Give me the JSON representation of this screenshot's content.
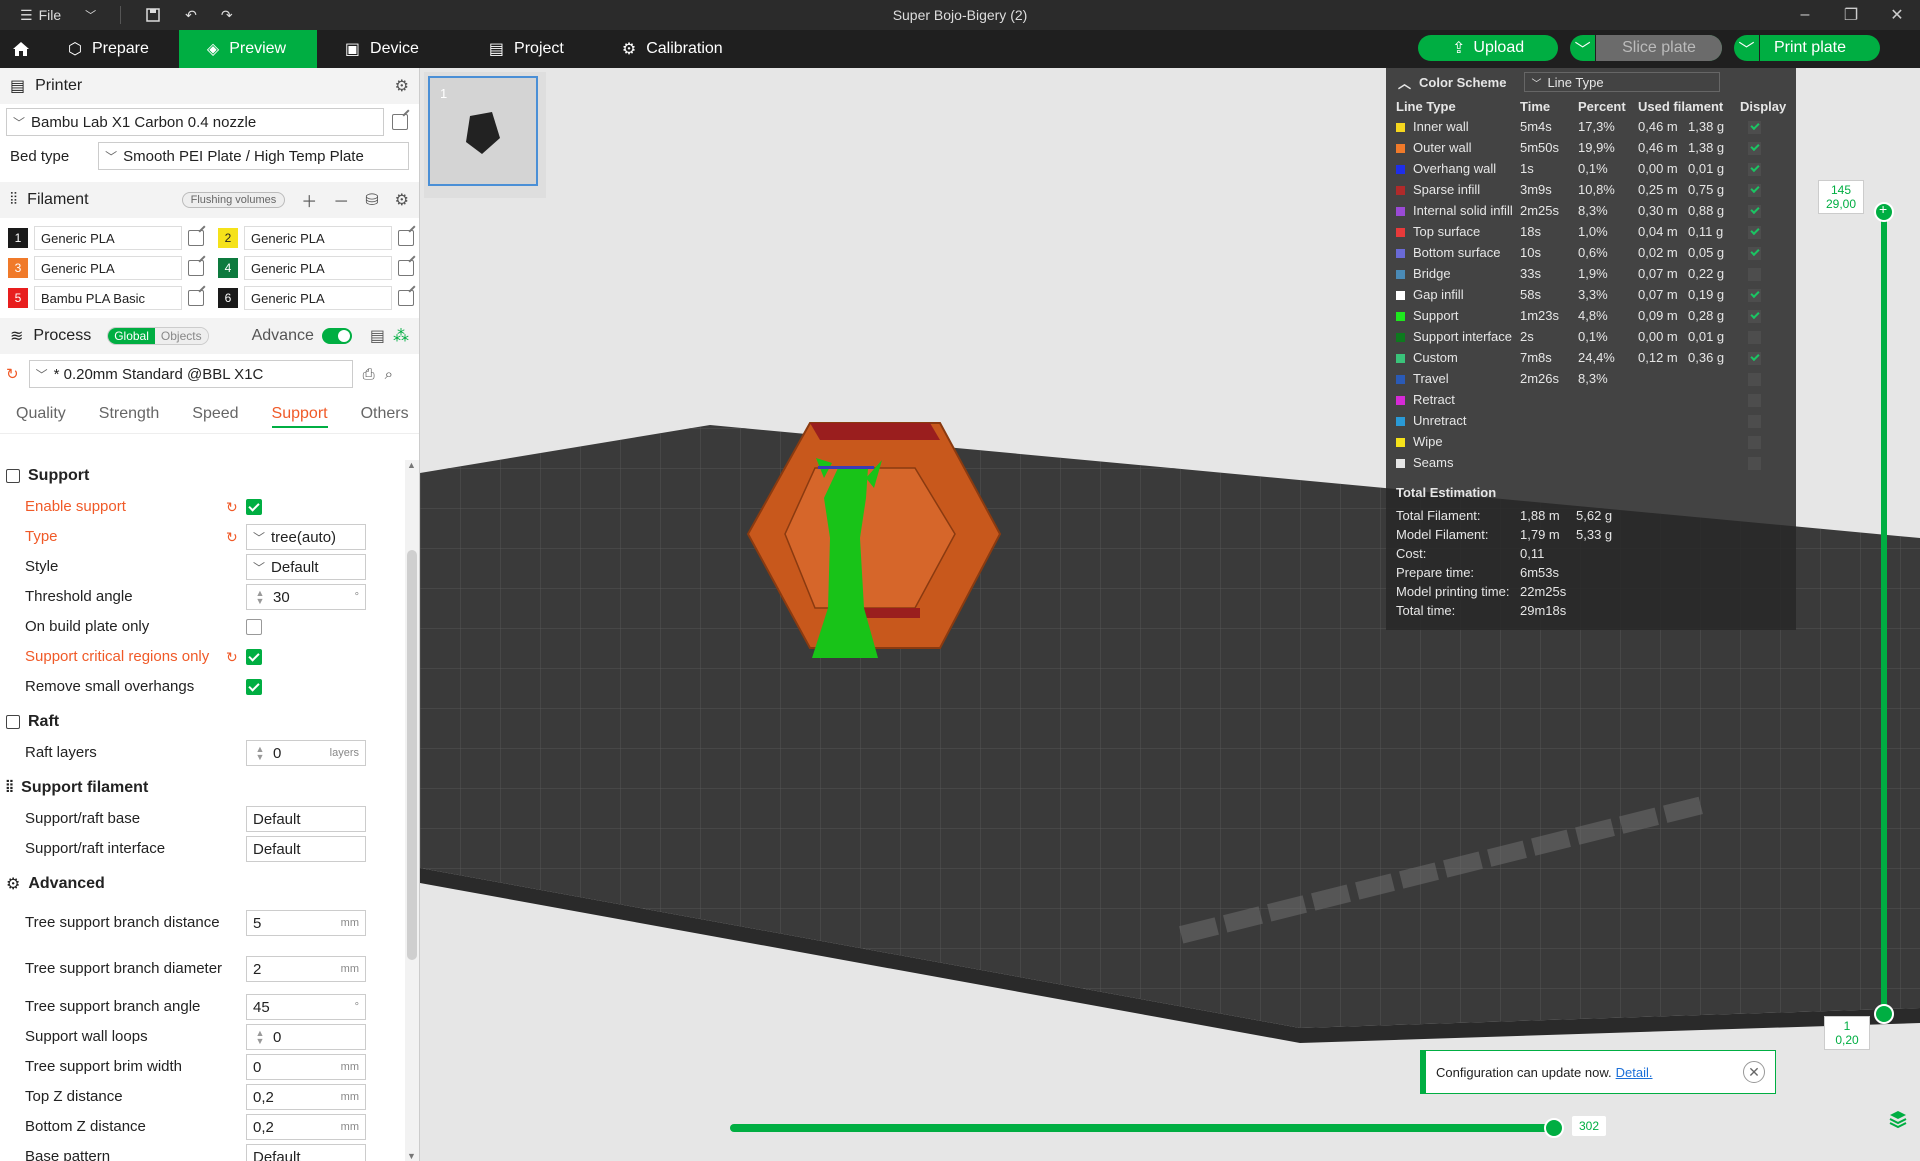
{
  "window": {
    "file_menu": "File",
    "title": "Super Bojo-Bigery (2)"
  },
  "nav": {
    "tabs": [
      {
        "label": "Prepare"
      },
      {
        "label": "Preview"
      },
      {
        "label": "Device"
      },
      {
        "label": "Project"
      },
      {
        "label": "Calibration"
      }
    ],
    "upload": "Upload",
    "slice_plate": "Slice plate",
    "print_plate": "Print plate"
  },
  "printer": {
    "header": "Printer",
    "name": "Bambu Lab X1 Carbon 0.4 nozzle",
    "bed_type_label": "Bed type",
    "bed_type": "Smooth PEI Plate / High Temp Plate"
  },
  "filament": {
    "header": "Filament",
    "flushing": "Flushing volumes",
    "items": [
      {
        "num": "1",
        "color": "#1a1a1a",
        "name": "Generic PLA"
      },
      {
        "num": "2",
        "color": "#f5e21a",
        "name": "Generic PLA"
      },
      {
        "num": "3",
        "color": "#f07a2a",
        "name": "Generic PLA"
      },
      {
        "num": "4",
        "color": "#0d7a3e",
        "name": "Generic PLA"
      },
      {
        "num": "5",
        "color": "#e81e1e",
        "name": "Bambu PLA Basic"
      },
      {
        "num": "6",
        "color": "#1a1a1a",
        "name": "Generic PLA"
      }
    ]
  },
  "process": {
    "header": "Process",
    "global": "Global",
    "objects": "Objects",
    "advance": "Advance",
    "preset": "* 0.20mm Standard @BBL X1C",
    "tabs": [
      "Quality",
      "Strength",
      "Speed",
      "Support",
      "Others"
    ]
  },
  "support": {
    "group": "Support",
    "enable_support": "Enable support",
    "type_label": "Type",
    "type_value": "tree(auto)",
    "style_label": "Style",
    "style_value": "Default",
    "threshold_label": "Threshold angle",
    "threshold_value": "30",
    "threshold_unit": "°",
    "build_plate_only": "On build plate only",
    "critical_regions": "Support critical regions only",
    "remove_small": "Remove small overhangs"
  },
  "raft": {
    "group": "Raft",
    "layers_label": "Raft layers",
    "layers_value": "0",
    "layers_unit": "layers"
  },
  "support_filament": {
    "group": "Support filament",
    "base_label": "Support/raft base",
    "base_value": "Default",
    "interface_label": "Support/raft interface",
    "interface_value": "Default"
  },
  "advanced": {
    "group": "Advanced",
    "branch_distance_label": "Tree support branch distance",
    "branch_distance_value": "5",
    "branch_diameter_label": "Tree support branch diameter",
    "branch_diameter_value": "2",
    "branch_angle_label": "Tree support branch angle",
    "branch_angle_value": "45",
    "wall_loops_label": "Support wall loops",
    "wall_loops_value": "0",
    "brim_width_label": "Tree support brim width",
    "brim_width_value": "0",
    "top_z_label": "Top Z distance",
    "top_z_value": "0,2",
    "bottom_z_label": "Bottom Z distance",
    "bottom_z_value": "0,2",
    "base_pattern_label": "Base pattern",
    "base_pattern_value": "Default",
    "unit_mm": "mm",
    "unit_deg": "°"
  },
  "plate": {
    "number": "1"
  },
  "legend": {
    "color_scheme": "Color Scheme",
    "scheme_value": "Line Type",
    "headers": [
      "Line Type",
      "Time",
      "Percent",
      "Used filament",
      "Display"
    ],
    "rows": [
      {
        "name": "Inner wall",
        "color": "#f5d61e",
        "time": "5m4s",
        "percent": "17,3%",
        "length": "0,46 m",
        "weight": "1,38 g",
        "shown": true
      },
      {
        "name": "Outer wall",
        "color": "#f07a2a",
        "time": "5m50s",
        "percent": "19,9%",
        "length": "0,46 m",
        "weight": "1,38 g",
        "shown": true
      },
      {
        "name": "Overhang wall",
        "color": "#1e2ee8",
        "time": "1s",
        "percent": "0,1%",
        "length": "0,00 m",
        "weight": "0,01 g",
        "shown": true
      },
      {
        "name": "Sparse infill",
        "color": "#b02a2a",
        "time": "3m9s",
        "percent": "10,8%",
        "length": "0,25 m",
        "weight": "0,75 g",
        "shown": true
      },
      {
        "name": "Internal solid infill",
        "color": "#9a4ad6",
        "time": "2m25s",
        "percent": "8,3%",
        "length": "0,30 m",
        "weight": "0,88 g",
        "shown": true
      },
      {
        "name": "Top surface",
        "color": "#e83a3a",
        "time": "18s",
        "percent": "1,0%",
        "length": "0,04 m",
        "weight": "0,11 g",
        "shown": true
      },
      {
        "name": "Bottom surface",
        "color": "#6a6ad6",
        "time": "10s",
        "percent": "0,6%",
        "length": "0,02 m",
        "weight": "0,05 g",
        "shown": true
      },
      {
        "name": "Bridge",
        "color": "#4a8ab6",
        "time": "33s",
        "percent": "1,9%",
        "length": "0,07 m",
        "weight": "0,22 g",
        "shown": false
      },
      {
        "name": "Gap infill",
        "color": "#ffffff",
        "time": "58s",
        "percent": "3,3%",
        "length": "0,07 m",
        "weight": "0,19 g",
        "shown": true
      },
      {
        "name": "Support",
        "color": "#1ee81e",
        "time": "1m23s",
        "percent": "4,8%",
        "length": "0,09 m",
        "weight": "0,28 g",
        "shown": true
      },
      {
        "name": "Support interface",
        "color": "#0d7a1e",
        "time": "2s",
        "percent": "0,1%",
        "length": "0,00 m",
        "weight": "0,01 g",
        "shown": false
      },
      {
        "name": "Custom",
        "color": "#3ac37a",
        "time": "7m8s",
        "percent": "24,4%",
        "length": "0,12 m",
        "weight": "0,36 g",
        "shown": true
      },
      {
        "name": "Travel",
        "color": "#2a5ab6",
        "time": "2m26s",
        "percent": "8,3%",
        "length": "",
        "weight": "",
        "shown": false
      },
      {
        "name": "Retract",
        "color": "#d62ad6",
        "time": "",
        "percent": "",
        "length": "",
        "weight": "",
        "shown": false
      },
      {
        "name": "Unretract",
        "color": "#2a9ad6",
        "time": "",
        "percent": "",
        "length": "",
        "weight": "",
        "shown": false
      },
      {
        "name": "Wipe",
        "color": "#f5e21a",
        "time": "",
        "percent": "",
        "length": "",
        "weight": "",
        "shown": false
      },
      {
        "name": "Seams",
        "color": "#e6e6e6",
        "time": "",
        "percent": "",
        "length": "",
        "weight": "",
        "shown": false
      }
    ],
    "total_title": "Total Estimation",
    "totals": [
      {
        "k": "Total Filament:",
        "v1": "1,88 m",
        "v2": "5,62 g"
      },
      {
        "k": "Model Filament:",
        "v1": "1,79 m",
        "v2": "5,33 g"
      },
      {
        "k": "Cost:",
        "v1": "0,11",
        "v2": ""
      },
      {
        "k": "Prepare time:",
        "v1": "6m53s",
        "v2": ""
      },
      {
        "k": "Model printing time:",
        "v1": "22m25s",
        "v2": ""
      },
      {
        "k": "Total time:",
        "v1": "29m18s",
        "v2": ""
      }
    ]
  },
  "layer_slider": {
    "top_layer": "145",
    "top_height": "29,00",
    "bottom_layer": "1",
    "bottom_height": "0,20"
  },
  "move_slider": {
    "value": "302"
  },
  "notification": {
    "text": "Configuration can update now.",
    "link": "Detail."
  }
}
